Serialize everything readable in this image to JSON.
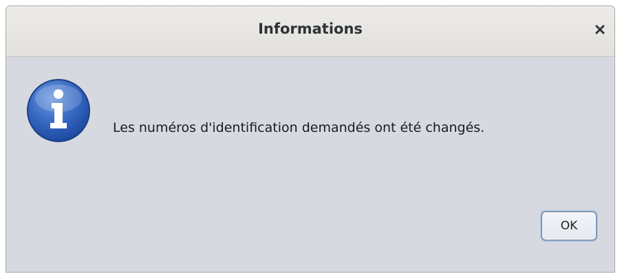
{
  "dialog": {
    "title": "Informations",
    "close_icon": "close-icon",
    "status_icon": "info-icon",
    "message": "Les numéros d'identification demandés ont été changés.",
    "ok_label": "OK"
  },
  "colors": {
    "dialog_background": "#d6d9df",
    "titlebar_background": "#e6e4e0",
    "info_icon_blue": "#2f5fb3",
    "ok_focus_ring": "#a7bfe0"
  }
}
